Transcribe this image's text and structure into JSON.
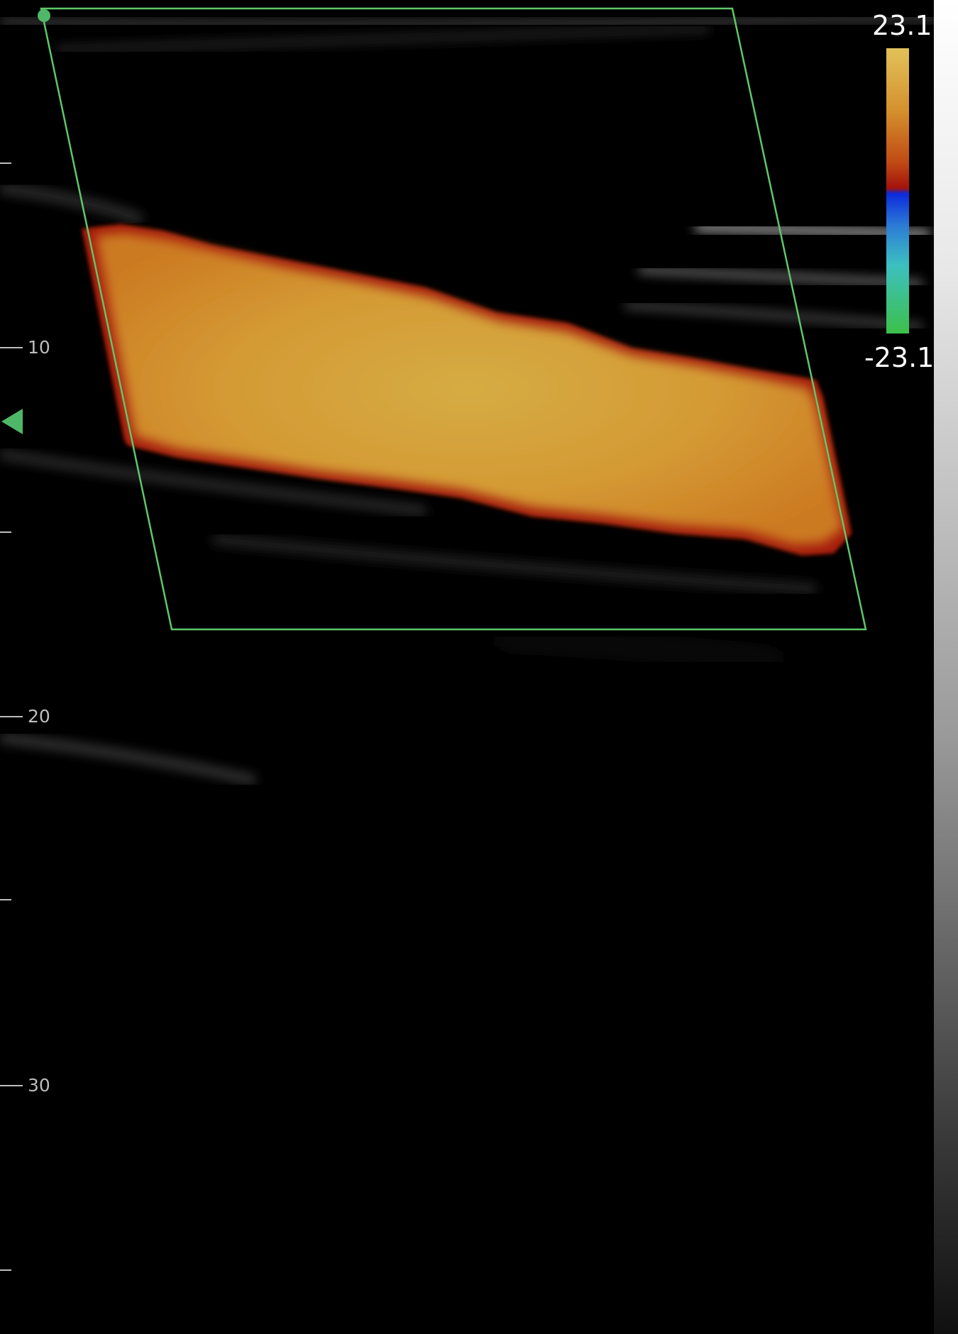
{
  "velocity_scale": {
    "max_label": "23.1",
    "min_label": "-23.1"
  },
  "depth_ruler": {
    "labels": [
      "10",
      "20",
      "30"
    ]
  },
  "colors": {
    "roi_box": "#5fc76a",
    "focus_marker": "#4fb868",
    "flow_core": "#d4a83c",
    "flow_edge": "#a51a08"
  }
}
